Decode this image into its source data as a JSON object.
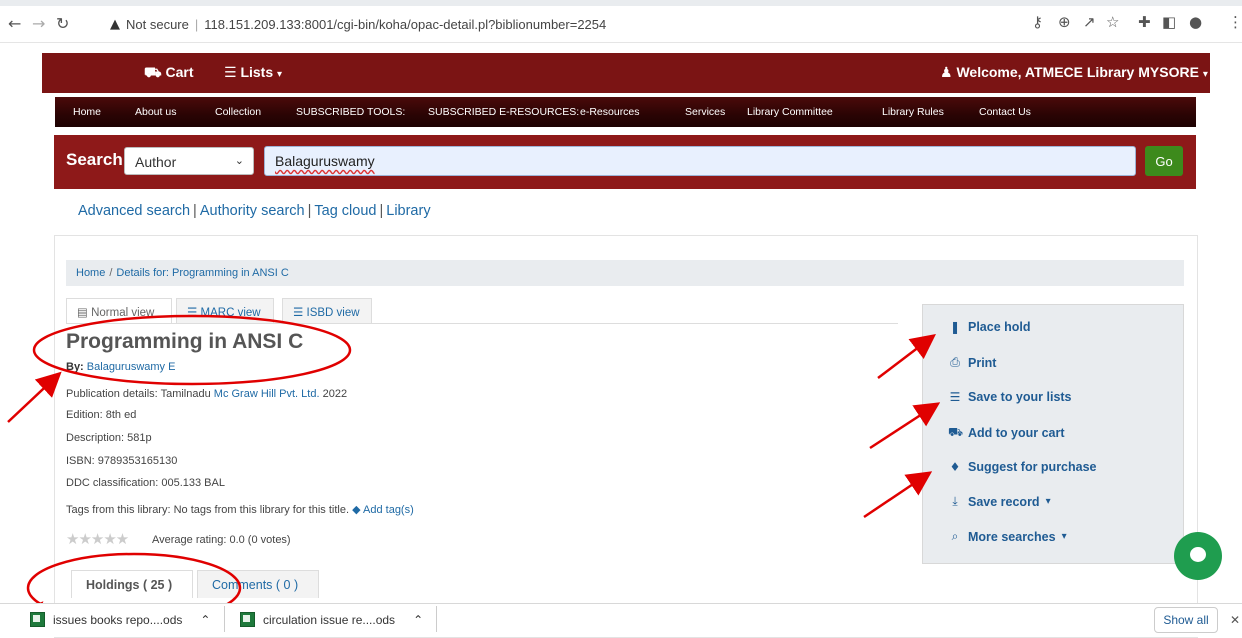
{
  "browser": {
    "security_label": "Not secure",
    "url": "118.151.209.133:8001/cgi-bin/koha/opac-detail.pl?biblionumber=2254"
  },
  "header": {
    "cart_label": "Cart",
    "lists_label": "Lists",
    "welcome": "Welcome, ATMECE Library MYSORE"
  },
  "menu": [
    "Home",
    "About us",
    "Collection",
    "SUBSCRIBED TOOLS:",
    "SUBSCRIBED E-RESOURCES:",
    "e-Resources",
    "Services",
    "Library Committee",
    "Library Rules",
    "Contact Us"
  ],
  "search": {
    "label": "Search",
    "index": "Author",
    "query": "Balaguruswamy",
    "go": "Go"
  },
  "links": [
    "Advanced search",
    "Authority search",
    "Tag cloud",
    "Library"
  ],
  "breadcrumb": {
    "home": "Home",
    "current": "Details for: Programming in ANSI C"
  },
  "view_tabs": [
    "Normal view",
    "MARC view",
    "ISBD view"
  ],
  "record": {
    "title": "Programming in ANSI C",
    "by_label": "By:",
    "author": "Balaguruswamy E",
    "publication_prefix": "Publication details: Tamilnadu",
    "publisher": "Mc Graw Hill Pvt. Ltd.",
    "publication_year": "2022",
    "edition": "Edition: 8th ed",
    "description": "Description: 581p",
    "isbn": "ISBN: 9789353165130",
    "ddc": "DDC classification: 005.133 BAL",
    "tags_text": "Tags from this library: No tags from this library for this title.",
    "add_tags": "Add tag(s)",
    "rating_text": "Average rating: 0.0 (0 votes)",
    "rating_value": 0
  },
  "bottom_tabs": [
    "Holdings ( 25 )",
    "Comments ( 0 )"
  ],
  "actions": [
    {
      "label": "Place hold",
      "icon": "bookmark-icon"
    },
    {
      "label": "Print",
      "icon": "print-icon"
    },
    {
      "label": "Save to your lists",
      "icon": "list-icon"
    },
    {
      "label": "Add to your cart",
      "icon": "cart-icon"
    },
    {
      "label": "Suggest for purchase",
      "icon": "gift-icon"
    },
    {
      "label": "Save record",
      "icon": "download-icon"
    },
    {
      "label": "More searches",
      "icon": "search-icon"
    }
  ],
  "downloads": [
    "issues books repo....ods",
    "circulation issue re....ods"
  ],
  "show_all": "Show all",
  "colors": {
    "header": "#7b1414",
    "search_band": "#8e1919",
    "go": "#3d8a1c",
    "link": "#1f6aa5",
    "annotation": "#e00000"
  }
}
